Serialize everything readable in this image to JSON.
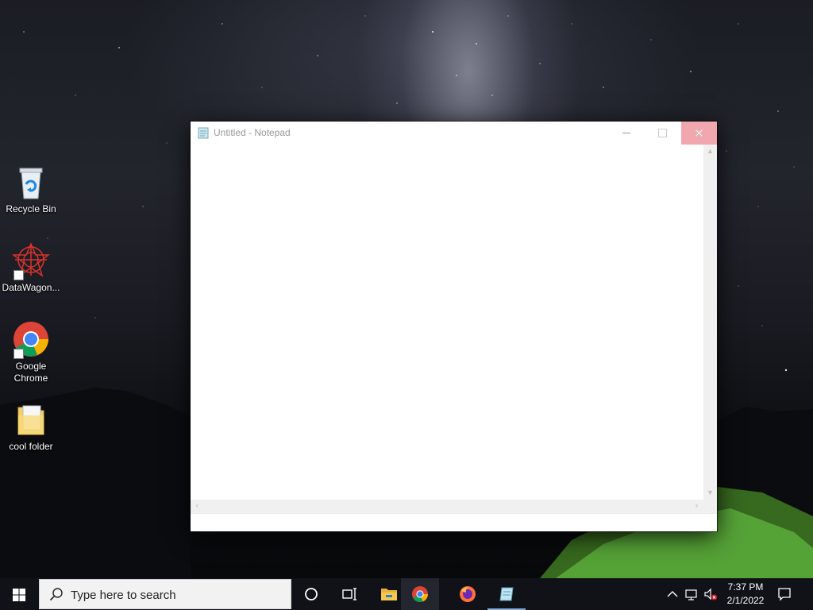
{
  "desktop": {
    "icons": [
      {
        "label": "Recycle Bin",
        "icon": "recycle-bin-icon"
      },
      {
        "label": "DataWagon...",
        "icon": "datawagon-icon"
      },
      {
        "label": "Google Chrome",
        "icon": "chrome-icon"
      },
      {
        "label": "cool folder",
        "icon": "folder-icon"
      }
    ]
  },
  "notepad": {
    "title": "Untitled - Notepad",
    "content": "",
    "controls": [
      "minimize",
      "maximize",
      "close"
    ]
  },
  "taskbar": {
    "search_placeholder": "Type here to search",
    "pinned": [
      {
        "name": "Cortana",
        "icon": "cortana-circle-icon"
      },
      {
        "name": "Task View",
        "icon": "task-view-icon"
      },
      {
        "name": "File Explorer",
        "icon": "file-explorer-icon"
      },
      {
        "name": "Google Chrome",
        "icon": "chrome-icon"
      },
      {
        "name": "Firefox",
        "icon": "firefox-icon"
      },
      {
        "name": "Notepad",
        "icon": "notepad-icon"
      }
    ],
    "clock": {
      "time": "7:37 PM",
      "date": "2/1/2022"
    },
    "tray": [
      "chevron-up-icon",
      "network-icon",
      "volume-muted-icon",
      "action-center-icon"
    ]
  },
  "colors": {
    "close_button": "#f1a7ae",
    "taskbar": "#101218",
    "active_indicator": "#86a8d6",
    "tent_glow": "#6fd24a"
  }
}
